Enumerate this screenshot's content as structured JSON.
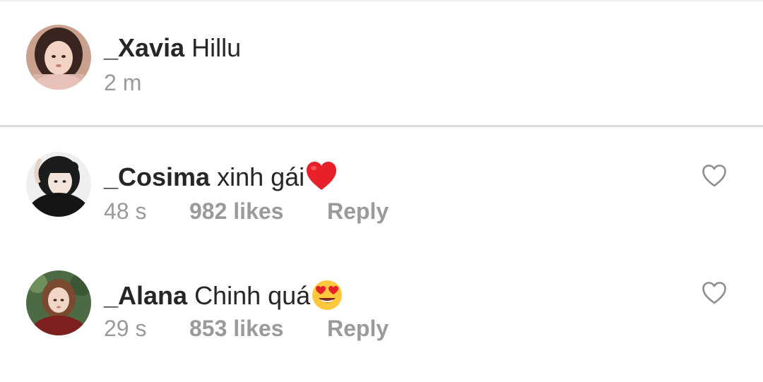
{
  "caption": {
    "username": "_Xavia",
    "text": "Hillu",
    "time": "2 m"
  },
  "comments": [
    {
      "username": "_Cosima",
      "text": "xinh gái",
      "emoji": "red-heart-emoji",
      "time": "48 s",
      "likes": "982 likes",
      "reply": "Reply"
    },
    {
      "username": "_Alana",
      "text": "Chinh quá",
      "emoji": "heart-eyes-emoji",
      "time": "29 s",
      "likes": "853 likes",
      "reply": "Reply"
    }
  ],
  "colors": {
    "text_primary": "#262626",
    "text_secondary": "#9a9a9a",
    "divider": "#dbdbdb",
    "emoji_heart": "#e8202a",
    "emoji_face": "#ffc83d"
  }
}
